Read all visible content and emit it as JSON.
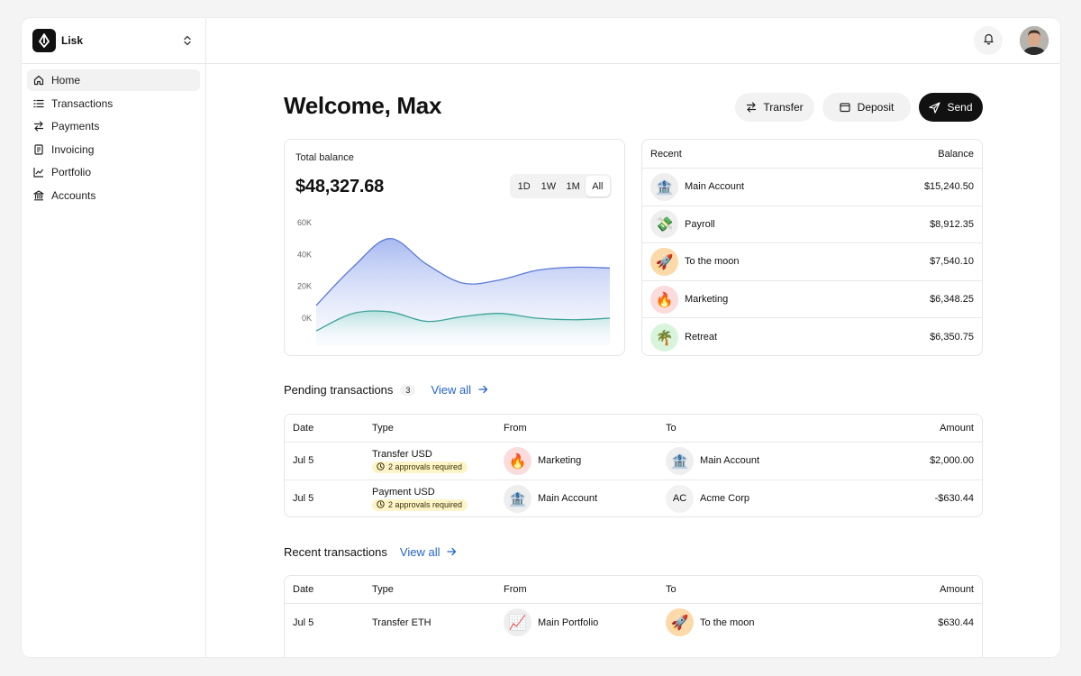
{
  "brand": {
    "name": "Lisk"
  },
  "sidebar": {
    "items": [
      {
        "label": "Home",
        "icon": "home-icon",
        "active": true
      },
      {
        "label": "Transactions",
        "icon": "list-icon"
      },
      {
        "label": "Payments",
        "icon": "arrows-icon"
      },
      {
        "label": "Invoicing",
        "icon": "document-icon"
      },
      {
        "label": "Portfolio",
        "icon": "chart-line-icon"
      },
      {
        "label": "Accounts",
        "icon": "bank-icon"
      }
    ]
  },
  "header": {
    "title": "Welcome, Max"
  },
  "actions": {
    "transfer": "Transfer",
    "deposit": "Deposit",
    "send": "Send"
  },
  "balance": {
    "label": "Total balance",
    "value": "$48,327.68",
    "ranges": [
      "1D",
      "1W",
      "1M",
      "All"
    ],
    "active_range": "All"
  },
  "chart_data": {
    "type": "area",
    "y_tick_labels": [
      "60K",
      "40K",
      "20K",
      "0K"
    ],
    "ylim": [
      0,
      60000
    ],
    "x": [
      0,
      1,
      2,
      3,
      4,
      5,
      6,
      7,
      8
    ],
    "series": [
      {
        "values": [
          8000,
          32000,
          50000,
          34000,
          22000,
          24000,
          30000,
          32000,
          31500
        ]
      },
      {
        "values": [
          -8000,
          3000,
          4000,
          -2000,
          1000,
          3000,
          0,
          -1000,
          0
        ]
      }
    ],
    "colors": [
      "#5b79d6",
      "#3fa39a"
    ],
    "grid": false
  },
  "recent": {
    "col_left": "Recent",
    "col_right": "Balance",
    "rows": [
      {
        "emoji": "🏦",
        "bg": "#eeeeef",
        "name": "Main Account",
        "amount": "$15,240.50"
      },
      {
        "emoji": "💸",
        "bg": "#eeeeef",
        "name": "Payroll",
        "amount": "$8,912.35"
      },
      {
        "emoji": "🚀",
        "bg": "#fbd9a8",
        "name": "To the moon",
        "amount": "$7,540.10"
      },
      {
        "emoji": "🔥",
        "bg": "#fbdcdc",
        "name": "Marketing",
        "amount": "$6,348.25"
      },
      {
        "emoji": "🌴",
        "bg": "#d8f5dc",
        "name": "Retreat",
        "amount": "$6,350.75"
      }
    ]
  },
  "pending": {
    "title": "Pending transactions",
    "count": "3",
    "view_all": "View all",
    "headers": {
      "date": "Date",
      "type": "Type",
      "from": "From",
      "to": "To",
      "amount": "Amount"
    },
    "rows": [
      {
        "date": "Jul 5",
        "type": "Transfer USD",
        "badge": "2 approvals required",
        "from": {
          "emoji": "🔥",
          "bg": "#fbdcdc",
          "name": "Marketing"
        },
        "to": {
          "emoji": "🏦",
          "bg": "#eeeeef",
          "name": "Main Account"
        },
        "amount": "$2,000.00"
      },
      {
        "date": "Jul 5",
        "type": "Payment USD",
        "badge": "2 approvals required",
        "from": {
          "emoji": "🏦",
          "bg": "#eeeeef",
          "name": "Main Account"
        },
        "to": {
          "initials": "AC",
          "name": "Acme Corp"
        },
        "amount": "-$630.44"
      }
    ]
  },
  "recent_tx": {
    "title": "Recent transactions",
    "view_all": "View all",
    "headers": {
      "date": "Date",
      "type": "Type",
      "from": "From",
      "to": "To",
      "amount": "Amount"
    },
    "rows": [
      {
        "date": "Jul 5",
        "type": "Transfer ETH",
        "from": {
          "emoji": "📈",
          "bg": "#eeeeef",
          "name": "Main Portfolio"
        },
        "to": {
          "emoji": "🚀",
          "bg": "#fbd9a8",
          "name": "To the moon"
        },
        "amount": "$630.44"
      }
    ]
  }
}
